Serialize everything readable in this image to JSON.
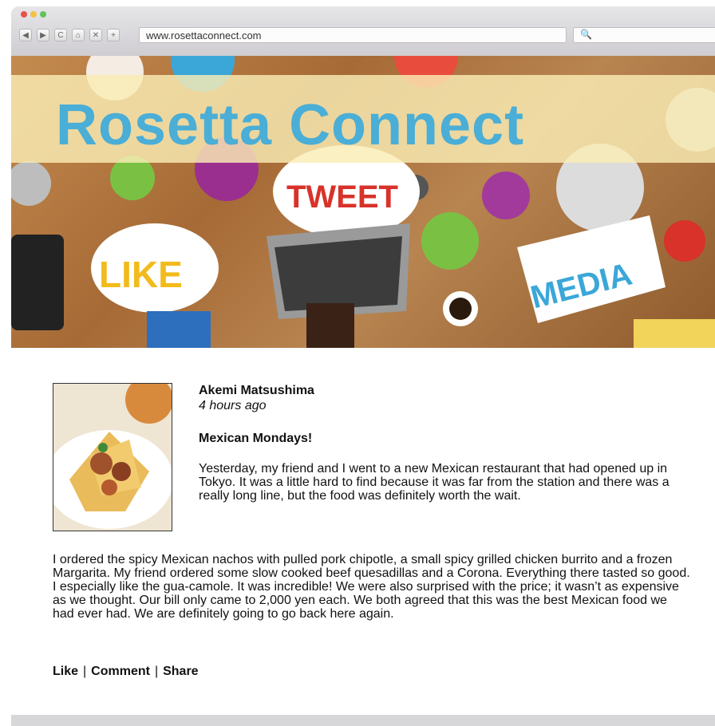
{
  "browser": {
    "url": "www.rosettaconnect.com",
    "search_icon": "🔍",
    "nav": {
      "back": "◀",
      "forward": "▶",
      "reload": "C",
      "home": "⌂",
      "close": "✕",
      "new_tab": "+"
    },
    "traffic_lights": [
      "#e8514b",
      "#f5c142",
      "#5fc45a"
    ]
  },
  "site": {
    "title": "Rosetta Connect",
    "title_color": "#4aaed6"
  },
  "banner": {
    "bubbles": [
      "LIKE",
      "TWEET",
      "MEDIA"
    ]
  },
  "post": {
    "author": "Akemi Matsushima",
    "time": "4 hours ago",
    "title": "Mexican Mondays!",
    "paragraph1": "Yesterday, my friend and I went to a new Mexican restaurant that had opened up in Tokyo. It was a little hard to find because it was far from the station and there was a really long line, but the food was definitely worth the wait.",
    "paragraph2": "I ordered the spicy Mexican nachos with pulled pork chipotle, a small spicy grilled chicken burrito and a frozen Margarita. My friend ordered some slow cooked beef quesadillas and a Corona. Everything there tasted so good. I especially like the gua-camole. It was incredible! We were also surprised with the price; it wasn’t as expensive as we thought. Our bill only came to 2,000 yen each. We both agreed that this was the best Mexican food we had ever had. We are definitely going to go back here again."
  },
  "actions": {
    "like": "Like",
    "comment": "Comment",
    "share": "Share",
    "separator": "|"
  }
}
